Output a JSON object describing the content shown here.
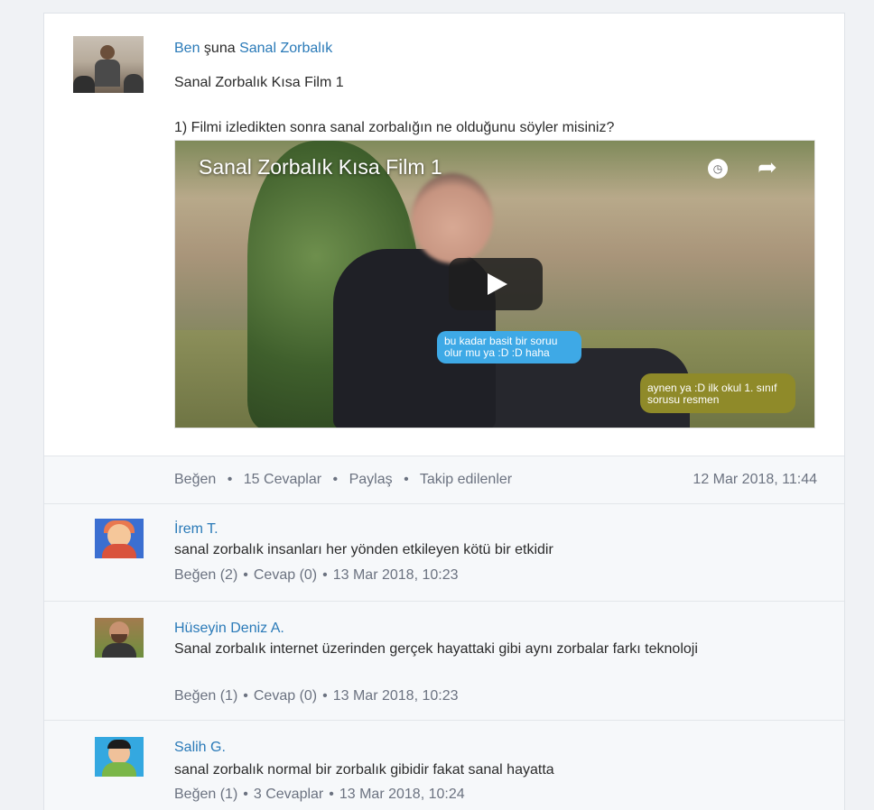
{
  "post": {
    "author": "Ben",
    "connector": "şuna",
    "target": "Sanal Zorbalık",
    "title": "Sanal Zorbalık Kısa Film 1",
    "question": "1) Filmi izledikten sonra sanal zorbalığın ne olduğunu söyler misiniz?",
    "video": {
      "title": "Sanal Zorbalık Kısa Film 1",
      "bubble_blue": "bu kadar basit bir soruu olur mu ya :D :D haha",
      "bubble_olive": "aynen ya :D ilk okul 1. sınıf sorusu resmen"
    },
    "actions": {
      "like": "Beğen",
      "replies": "15 Cevaplar",
      "share": "Paylaş",
      "follow": "Takip edilenler",
      "separator": "•",
      "date": "12 Mar 2018, 11:44"
    }
  },
  "replies": [
    {
      "name": "İrem T.",
      "text": "sanal zorbalık insanları her yönden etkileyen kötü bir etkidir",
      "like": "Beğen (2)",
      "reply": "Cevap (0)",
      "date": "13 Mar 2018, 10:23"
    },
    {
      "name": "Hüseyin Deniz A.",
      "text": "Sanal zorbalık internet üzerinden gerçek hayattaki gibi aynı zorbalar farkı teknoloji",
      "like": "Beğen (1)",
      "reply": "Cevap (0)",
      "date": "13 Mar 2018, 10:23"
    },
    {
      "name": "Salih G.",
      "text": "sanal zorbalık normal bir zorbalık gibidir fakat sanal hayatta",
      "like": "Beğen (1)",
      "reply": "3 Cevaplar",
      "date": "13 Mar 2018, 10:24"
    }
  ],
  "icons": {
    "clock": "clock-icon",
    "share": "share-icon",
    "play": "play-icon"
  },
  "colors": {
    "link": "#2a7ab8",
    "muted": "#6b7280",
    "bubble_blue": "#3ea9e6",
    "bubble_olive": "#8f8a29"
  }
}
